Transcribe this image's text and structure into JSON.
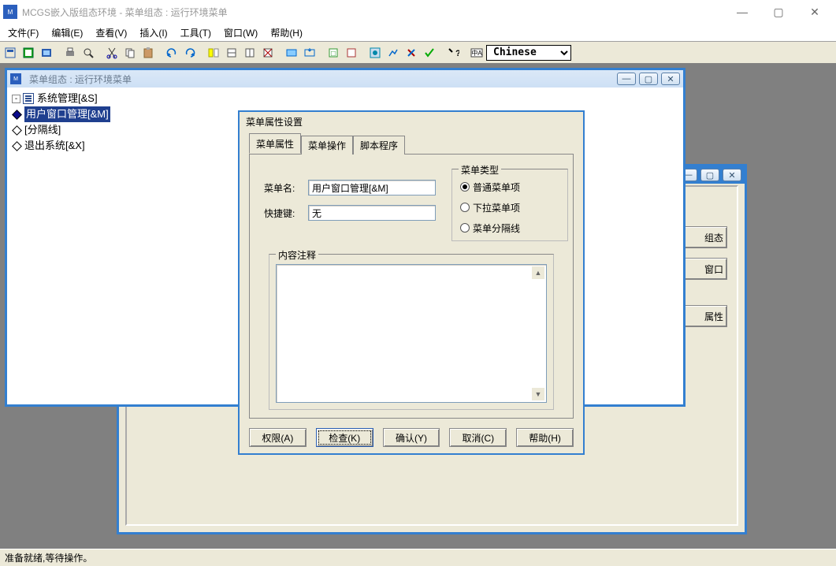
{
  "app": {
    "title": "MCGS嵌入版组态环境 - 菜单组态 : 运行环境菜单",
    "status": "准备就绪,等待操作。"
  },
  "winbtns": {
    "min": "—",
    "max": "▢",
    "close": "✕"
  },
  "menu": {
    "file": "文件(F)",
    "edit": "编辑(E)",
    "view": "查看(V)",
    "insert": "插入(I)",
    "tools": "工具(T)",
    "window": "窗口(W)",
    "help": "帮助(H)"
  },
  "toolbar": {
    "language": "Chinese"
  },
  "mdi_back": {
    "side_buttons": {
      "b1": "组态",
      "b2": "窗口",
      "b3": "属性"
    }
  },
  "mdi_front": {
    "title": "菜单组态 : 运行环境菜单",
    "tree": {
      "root": "系统管理[&S]",
      "n1": "用户窗口管理[&M]",
      "n2": "[分隔线]",
      "n3": "退出系统[&X]"
    }
  },
  "dialog": {
    "title": "菜单属性设置",
    "tabs": {
      "t1": "菜单属性",
      "t2": "菜单操作",
      "t3": "脚本程序"
    },
    "fields": {
      "name_lbl": "菜单名:",
      "name_val": "用户窗口管理[&M]",
      "hotkey_lbl": "快捷键:",
      "hotkey_val": "无"
    },
    "type_group": {
      "legend": "菜单类型",
      "r1": "普通菜单项",
      "r2": "下拉菜单项",
      "r3": "菜单分隔线"
    },
    "comment_legend": "内容注释",
    "buttons": {
      "perm": "权限(A)",
      "check": "检查(K)",
      "ok": "确认(Y)",
      "cancel": "取消(C)",
      "help": "帮助(H)"
    }
  }
}
